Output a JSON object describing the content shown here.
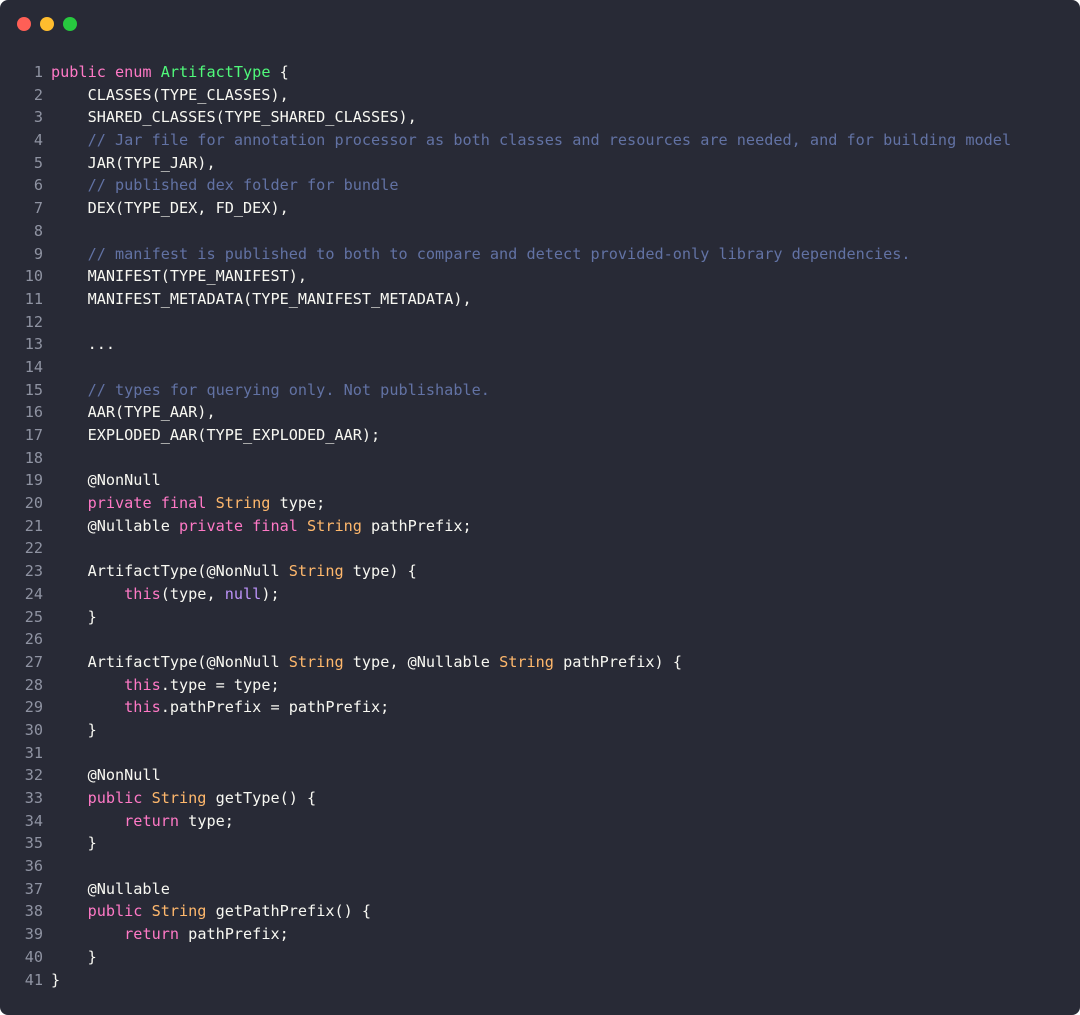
{
  "window": {
    "controls": [
      {
        "name": "close",
        "color": "#ff5f56"
      },
      {
        "name": "minimize",
        "color": "#ffbd2e"
      },
      {
        "name": "maximize",
        "color": "#27c93f"
      }
    ]
  },
  "theme": {
    "background": "#282a36",
    "keyword": "#ff79c6",
    "class_name": "#50fa7b",
    "type": "#ffb86c",
    "comment": "#6272a4",
    "null": "#bd93f9",
    "text": "#f8f8f2",
    "line_number": "#8f93a2"
  },
  "code": {
    "lines": [
      {
        "n": "1",
        "tokens": [
          [
            "kw",
            "public enum "
          ],
          [
            "cls",
            "ArtifactType"
          ],
          [
            "plain",
            " {"
          ]
        ]
      },
      {
        "n": "2",
        "tokens": [
          [
            "plain",
            "    CLASSES(TYPE_CLASSES),"
          ]
        ]
      },
      {
        "n": "3",
        "tokens": [
          [
            "plain",
            "    SHARED_CLASSES(TYPE_SHARED_CLASSES),"
          ]
        ]
      },
      {
        "n": "4",
        "tokens": [
          [
            "plain",
            "    "
          ],
          [
            "comment",
            "// Jar file for annotation processor as both classes and resources are needed, and for building model"
          ]
        ]
      },
      {
        "n": "5",
        "tokens": [
          [
            "plain",
            "    JAR(TYPE_JAR),"
          ]
        ]
      },
      {
        "n": "6",
        "tokens": [
          [
            "plain",
            "    "
          ],
          [
            "comment",
            "// published dex folder for bundle"
          ]
        ]
      },
      {
        "n": "7",
        "tokens": [
          [
            "plain",
            "    DEX(TYPE_DEX, FD_DEX),"
          ]
        ]
      },
      {
        "n": "8",
        "tokens": []
      },
      {
        "n": "9",
        "tokens": [
          [
            "plain",
            "    "
          ],
          [
            "comment",
            "// manifest is published to both to compare and detect provided-only library dependencies."
          ]
        ]
      },
      {
        "n": "10",
        "tokens": [
          [
            "plain",
            "    MANIFEST(TYPE_MANIFEST),"
          ]
        ]
      },
      {
        "n": "11",
        "tokens": [
          [
            "plain",
            "    MANIFEST_METADATA(TYPE_MANIFEST_METADATA),"
          ]
        ]
      },
      {
        "n": "12",
        "tokens": []
      },
      {
        "n": "13",
        "tokens": [
          [
            "plain",
            "    ..."
          ]
        ]
      },
      {
        "n": "14",
        "tokens": []
      },
      {
        "n": "15",
        "tokens": [
          [
            "plain",
            "    "
          ],
          [
            "comment",
            "// types for querying only. Not publishable."
          ]
        ]
      },
      {
        "n": "16",
        "tokens": [
          [
            "plain",
            "    AAR(TYPE_AAR),"
          ]
        ]
      },
      {
        "n": "17",
        "tokens": [
          [
            "plain",
            "    EXPLODED_AAR(TYPE_EXPLODED_AAR);"
          ]
        ]
      },
      {
        "n": "18",
        "tokens": []
      },
      {
        "n": "19",
        "tokens": [
          [
            "plain",
            "    @NonNull"
          ]
        ]
      },
      {
        "n": "20",
        "tokens": [
          [
            "plain",
            "    "
          ],
          [
            "kw",
            "private final "
          ],
          [
            "type",
            "String"
          ],
          [
            "plain",
            " type;"
          ]
        ]
      },
      {
        "n": "21",
        "tokens": [
          [
            "plain",
            "    @Nullable "
          ],
          [
            "kw",
            "private final "
          ],
          [
            "type",
            "String"
          ],
          [
            "plain",
            " pathPrefix;"
          ]
        ]
      },
      {
        "n": "22",
        "tokens": []
      },
      {
        "n": "23",
        "tokens": [
          [
            "plain",
            "    ArtifactType(@NonNull "
          ],
          [
            "type",
            "String"
          ],
          [
            "plain",
            " type) {"
          ]
        ]
      },
      {
        "n": "24",
        "tokens": [
          [
            "plain",
            "        "
          ],
          [
            "this",
            "this"
          ],
          [
            "plain",
            "(type, "
          ],
          [
            "null",
            "null"
          ],
          [
            "plain",
            ");"
          ]
        ]
      },
      {
        "n": "25",
        "tokens": [
          [
            "plain",
            "    }"
          ]
        ]
      },
      {
        "n": "26",
        "tokens": []
      },
      {
        "n": "27",
        "tokens": [
          [
            "plain",
            "    ArtifactType(@NonNull "
          ],
          [
            "type",
            "String"
          ],
          [
            "plain",
            " type, @Nullable "
          ],
          [
            "type",
            "String"
          ],
          [
            "plain",
            " pathPrefix) {"
          ]
        ]
      },
      {
        "n": "28",
        "tokens": [
          [
            "plain",
            "        "
          ],
          [
            "this",
            "this"
          ],
          [
            "plain",
            ".type = type;"
          ]
        ]
      },
      {
        "n": "29",
        "tokens": [
          [
            "plain",
            "        "
          ],
          [
            "this",
            "this"
          ],
          [
            "plain",
            ".pathPrefix = pathPrefix;"
          ]
        ]
      },
      {
        "n": "30",
        "tokens": [
          [
            "plain",
            "    }"
          ]
        ]
      },
      {
        "n": "31",
        "tokens": []
      },
      {
        "n": "32",
        "tokens": [
          [
            "plain",
            "    @NonNull"
          ]
        ]
      },
      {
        "n": "33",
        "tokens": [
          [
            "plain",
            "    "
          ],
          [
            "kw",
            "public "
          ],
          [
            "type",
            "String"
          ],
          [
            "plain",
            " getType() {"
          ]
        ]
      },
      {
        "n": "34",
        "tokens": [
          [
            "plain",
            "        "
          ],
          [
            "kw",
            "return"
          ],
          [
            "plain",
            " type;"
          ]
        ]
      },
      {
        "n": "35",
        "tokens": [
          [
            "plain",
            "    }"
          ]
        ]
      },
      {
        "n": "36",
        "tokens": []
      },
      {
        "n": "37",
        "tokens": [
          [
            "plain",
            "    @Nullable"
          ]
        ]
      },
      {
        "n": "38",
        "tokens": [
          [
            "plain",
            "    "
          ],
          [
            "kw",
            "public "
          ],
          [
            "type",
            "String"
          ],
          [
            "plain",
            " getPathPrefix() {"
          ]
        ]
      },
      {
        "n": "39",
        "tokens": [
          [
            "plain",
            "        "
          ],
          [
            "kw",
            "return"
          ],
          [
            "plain",
            " pathPrefix;"
          ]
        ]
      },
      {
        "n": "40",
        "tokens": [
          [
            "plain",
            "    }"
          ]
        ]
      },
      {
        "n": "41",
        "tokens": [
          [
            "plain",
            "}"
          ]
        ]
      }
    ]
  }
}
